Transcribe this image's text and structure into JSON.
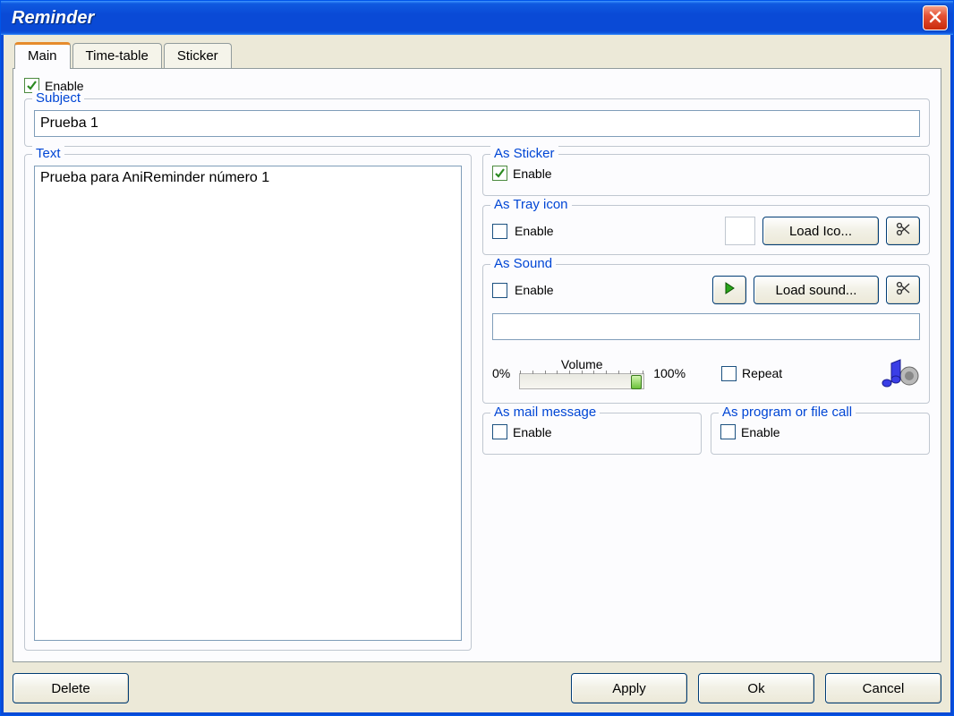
{
  "window": {
    "title": "Reminder"
  },
  "tabs": {
    "main": "Main",
    "timetable": "Time-table",
    "sticker": "Sticker"
  },
  "main": {
    "enable_label": "Enable",
    "enable_checked": true,
    "subject": {
      "legend": "Subject",
      "value": "Prueba 1"
    },
    "text": {
      "legend": "Text",
      "value": "Prueba para AniReminder número 1"
    },
    "as_sticker": {
      "legend": "As Sticker",
      "enable_label": "Enable",
      "checked": true
    },
    "as_tray": {
      "legend": "As Tray icon",
      "enable_label": "Enable",
      "checked": false,
      "load_btn": "Load Ico..."
    },
    "as_sound": {
      "legend": "As Sound",
      "enable_label": "Enable",
      "checked": false,
      "load_btn": "Load sound...",
      "path": "",
      "volume_label": "Volume",
      "vol_min": "0%",
      "vol_max": "100%",
      "vol_value": 100,
      "repeat_label": "Repeat",
      "repeat_checked": false
    },
    "as_mail": {
      "legend": "As mail message",
      "enable_label": "Enable",
      "checked": false
    },
    "as_program": {
      "legend": "As program or file call",
      "enable_label": "Enable",
      "checked": false
    }
  },
  "buttons": {
    "delete": "Delete",
    "apply": "Apply",
    "ok": "Ok",
    "cancel": "Cancel"
  }
}
